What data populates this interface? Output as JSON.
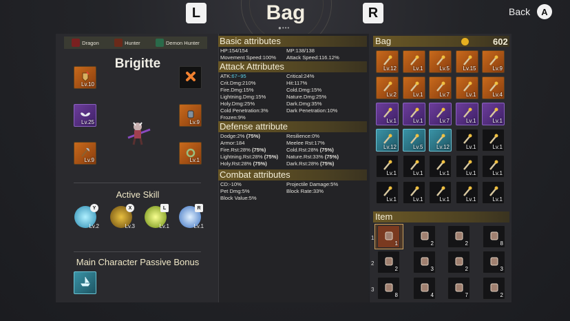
{
  "header": {
    "title": "Bag",
    "left_key": "L",
    "right_key": "R",
    "back_label": "Back",
    "back_key": "A",
    "page_dots": "●•••"
  },
  "classes": [
    {
      "name": "Dragon"
    },
    {
      "name": "Hunter"
    },
    {
      "name": "Demon Hunter"
    }
  ],
  "character": {
    "name": "Brigitte"
  },
  "equipment": [
    {
      "slot": "top-left",
      "level": "Lv.10",
      "rarity": "orange"
    },
    {
      "slot": "top-right",
      "level": "",
      "rarity": "black"
    },
    {
      "slot": "mid-left",
      "level": "Lv.25",
      "rarity": "purple"
    },
    {
      "slot": "mid-right",
      "level": "Lv.9",
      "rarity": "orange"
    },
    {
      "slot": "bot-left",
      "level": "Lv.9",
      "rarity": "orange"
    },
    {
      "slot": "bot-right",
      "level": "Lv.1",
      "rarity": "orange"
    }
  ],
  "active_skill": {
    "title": "Active Skill",
    "skills": [
      {
        "key": "Y",
        "level": "Lv.2"
      },
      {
        "key": "X",
        "level": "Lv.3"
      },
      {
        "key": "L",
        "level": "Lv.1"
      },
      {
        "key": "R",
        "level": "Lv.1"
      }
    ]
  },
  "passive": {
    "title": "Main Character Passive Bonus"
  },
  "basic": {
    "title": "Basic attributes",
    "hp": "HP:154/154",
    "mp": "MP:138/138",
    "move": "Movement Speed:100%",
    "atkspd": "Attack Speed:116.12%"
  },
  "attack": {
    "title": "Attack Attributes",
    "atk_label": "ATK:",
    "atk_value": "67~95",
    "critical": "Critical:24%",
    "critdmg": "Crit.Dmg:210%",
    "hit": "Hit:117%",
    "fire": "Fire.Dmg:15%",
    "cold": "Cold.Dmg:15%",
    "lightning": "Lightning.Dmg:15%",
    "nature": "Nature.Dmg:25%",
    "holy": "Holy.Dmg:25%",
    "dark": "Dark.Dmg:35%",
    "coldpen": "Cold Penetration:3%",
    "darkpen": "Dark Penetration:10%",
    "frozen": "Frozen:9%"
  },
  "defense": {
    "title": "Defense attribute",
    "dodge": "Dodge:2%",
    "dodge_b": "(75%)",
    "resilience": "Resilience:0%",
    "armor": "Armor:184",
    "meelee": "Meelee Rst:17%",
    "firerst": "Fire.Rst:28%",
    "firerst_b": "(75%)",
    "coldrst": "Cold.Rst:28%",
    "coldrst_b": "(75%)",
    "lightrst": "Lightning.Rst:28%",
    "lightrst_b": "(75%)",
    "naturerst": "Nature.Rst:33%",
    "naturerst_b": "(75%)",
    "holyrst": "Holy.Rst:28%",
    "holyrst_b": "(75%)",
    "darkrst": "Dark.Rst:28%",
    "darkrst_b": "(75%)"
  },
  "combat": {
    "title": "Combat attributes",
    "cd": "CD:-10%",
    "proj": "Projectile Damage:5%",
    "pet": "Pet Dmg:5%",
    "block": "Block Rate:33%",
    "blockval": "Block Value:5%"
  },
  "bag": {
    "title": "Bag",
    "gold": "602",
    "rows": [
      [
        {
          "l": "Lv.12",
          "r": "orange"
        },
        {
          "l": "Lv.1",
          "r": "orange"
        },
        {
          "l": "Lv.5",
          "r": "orange"
        },
        {
          "l": "Lv.15",
          "r": "orange"
        },
        {
          "l": "Lv.9",
          "r": "orange"
        }
      ],
      [
        {
          "l": "Lv.2",
          "r": "orange"
        },
        {
          "l": "Lv.1",
          "r": "orange"
        },
        {
          "l": "Lv.7",
          "r": "orange"
        },
        {
          "l": "Lv.1",
          "r": "orange"
        },
        {
          "l": "Lv.4",
          "r": "orange"
        }
      ],
      [
        {
          "l": "Lv.1",
          "r": "purple"
        },
        {
          "l": "Lv.1",
          "r": "purple"
        },
        {
          "l": "Lv.7",
          "r": "purple"
        },
        {
          "l": "Lv.1",
          "r": "purple"
        },
        {
          "l": "Lv.1",
          "r": "purple"
        }
      ],
      [
        {
          "l": "Lv.12",
          "r": "cyan"
        },
        {
          "l": "Lv.5",
          "r": "cyan"
        },
        {
          "l": "Lv.12",
          "r": "cyan"
        },
        {
          "l": "Lv.1",
          "r": "dark"
        },
        {
          "l": "Lv.1",
          "r": "dark"
        }
      ],
      [
        {
          "l": "Lv.1",
          "r": "dark"
        },
        {
          "l": "Lv.1",
          "r": "dark"
        },
        {
          "l": "Lv.1",
          "r": "dark"
        },
        {
          "l": "Lv.1",
          "r": "dark"
        },
        {
          "l": "Lv.1",
          "r": "dark"
        }
      ],
      [
        {
          "l": "Lv.1",
          "r": "dark"
        },
        {
          "l": "Lv.1",
          "r": "dark"
        },
        {
          "l": "Lv.1",
          "r": "dark"
        },
        {
          "l": "Lv.1",
          "r": "dark"
        },
        {
          "l": "Lv.1",
          "r": "dark"
        }
      ]
    ]
  },
  "items": {
    "title": "Item",
    "row_labels": [
      "1",
      "2",
      "3"
    ],
    "rows": [
      [
        "1",
        "2",
        "2",
        "8"
      ],
      [
        "2",
        "3",
        "2",
        "3"
      ],
      [
        "8",
        "4",
        "7",
        "2"
      ]
    ]
  },
  "colors": {
    "orange": "#c86a1c",
    "purple": "#6c3d9a",
    "cyan": "#3a93a6",
    "header": "#6a5826",
    "atk": "#5ad0e6"
  }
}
